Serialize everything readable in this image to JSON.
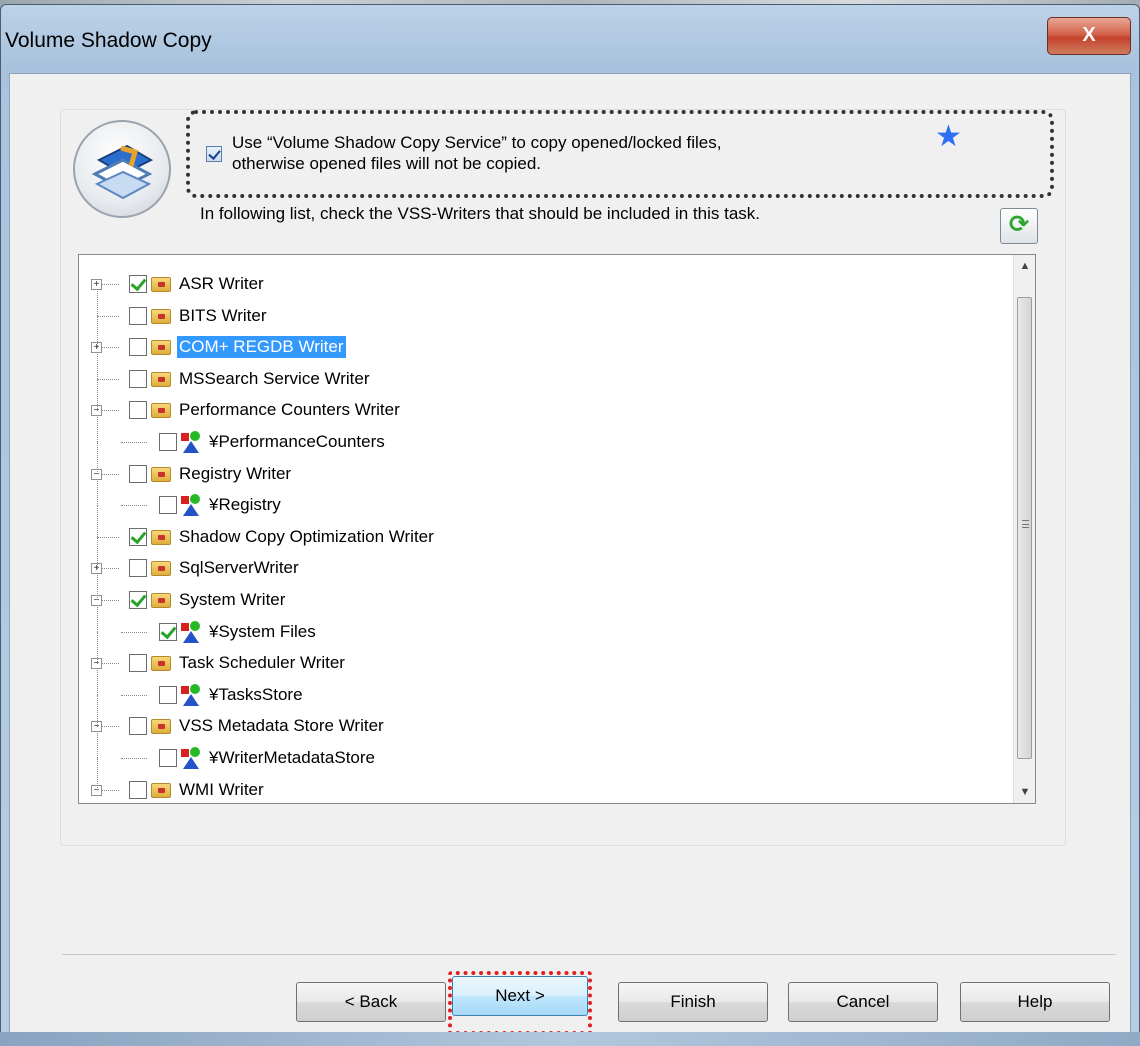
{
  "window": {
    "title": "Volume Shadow Copy",
    "close_label": "X"
  },
  "vss": {
    "checkbox_checked": true,
    "label_line1": "Use “Volume Shadow Copy Service” to copy opened/locked files,",
    "label_line2": "otherwise opened files will not be copied.",
    "instruction": "In following list, check the VSS-Writers that should be included in this task."
  },
  "tree": {
    "items": [
      {
        "label": "ASR Writer",
        "level": 0,
        "expander": "+",
        "checked": true,
        "icon": "folder-icon"
      },
      {
        "label": "BITS Writer",
        "level": 0,
        "expander": "",
        "checked": false,
        "icon": "folder-icon"
      },
      {
        "label": "COM+ REGDB Writer",
        "level": 0,
        "expander": "+",
        "checked": false,
        "icon": "folder-icon",
        "selected": true
      },
      {
        "label": "MSSearch Service Writer",
        "level": 0,
        "expander": "",
        "checked": false,
        "icon": "folder-icon"
      },
      {
        "label": "Performance Counters Writer",
        "level": 0,
        "expander": "-",
        "checked": false,
        "icon": "folder-icon"
      },
      {
        "label": "¥PerformanceCounters",
        "level": 1,
        "expander": "",
        "checked": false,
        "icon": "component-icon"
      },
      {
        "label": "Registry Writer",
        "level": 0,
        "expander": "-",
        "checked": false,
        "icon": "folder-icon"
      },
      {
        "label": "¥Registry",
        "level": 1,
        "expander": "",
        "checked": false,
        "icon": "component-icon"
      },
      {
        "label": "Shadow Copy Optimization Writer",
        "level": 0,
        "expander": "",
        "checked": true,
        "icon": "folder-icon"
      },
      {
        "label": "SqlServerWriter",
        "level": 0,
        "expander": "+",
        "checked": false,
        "icon": "folder-icon"
      },
      {
        "label": "System Writer",
        "level": 0,
        "expander": "-",
        "checked": true,
        "icon": "folder-icon"
      },
      {
        "label": "¥System Files",
        "level": 1,
        "expander": "",
        "checked": true,
        "icon": "component-icon"
      },
      {
        "label": "Task Scheduler Writer",
        "level": 0,
        "expander": "-",
        "checked": false,
        "icon": "folder-icon"
      },
      {
        "label": "¥TasksStore",
        "level": 1,
        "expander": "",
        "checked": false,
        "icon": "component-icon"
      },
      {
        "label": "VSS Metadata Store Writer",
        "level": 0,
        "expander": "-",
        "checked": false,
        "icon": "folder-icon"
      },
      {
        "label": "¥WriterMetadataStore",
        "level": 1,
        "expander": "",
        "checked": false,
        "icon": "component-icon"
      },
      {
        "label": "WMI Writer",
        "level": 0,
        "expander": "-",
        "checked": false,
        "icon": "folder-icon"
      }
    ]
  },
  "buttons": {
    "back": "< Back",
    "next": "Next >",
    "finish": "Finish",
    "cancel": "Cancel",
    "help": "Help"
  },
  "colors": {
    "selection": "#3399ff",
    "check": "#27a327",
    "focus_highlight": "#e02020",
    "callout_border": "#333333"
  }
}
